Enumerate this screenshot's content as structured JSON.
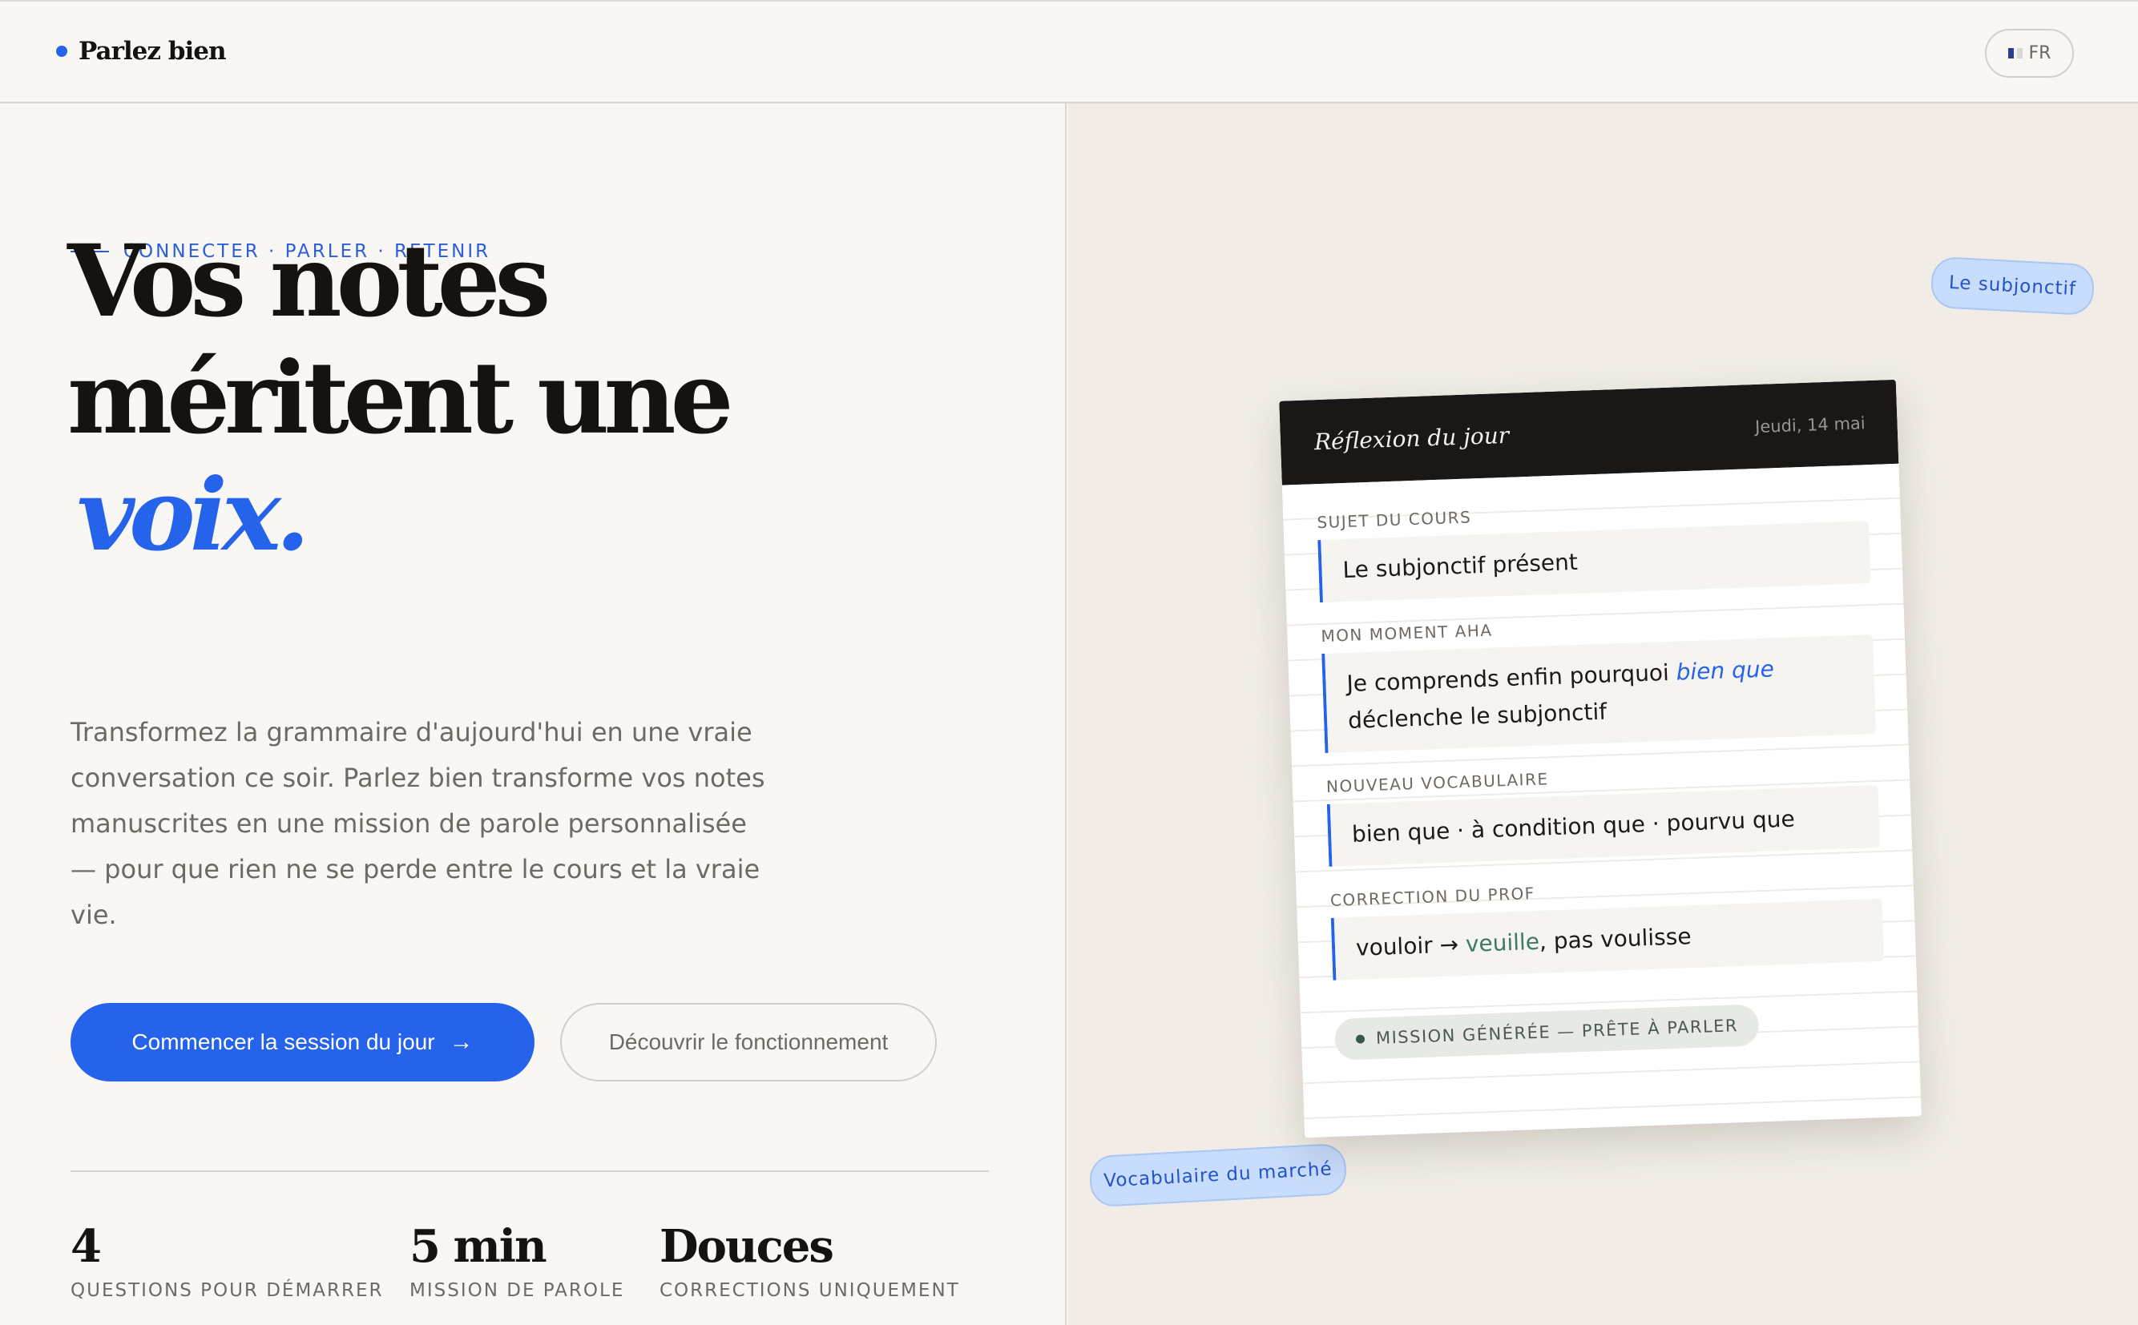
{
  "header": {
    "brand": "Parlez bien",
    "lang_label": "FR"
  },
  "hero": {
    "eyebrow": "CONNECTER · PARLER · RETENIR",
    "title_line1": "Vos notes",
    "title_line2": "méritent une",
    "title_accent": "voix.",
    "lede": "Transformez la grammaire d'aujourd'hui en une vraie conversation ce soir. Parlez bien transforme vos notes manuscrites en une mission de parole personnalisée — pour que rien ne se perde entre le cours et la vraie vie.",
    "primary_cta": "Commencer la session du jour",
    "primary_cta_icon": "→",
    "secondary_cta": "Découvrir le fonctionnement"
  },
  "stats": [
    {
      "value": "4",
      "label": "QUESTIONS POUR DÉMARRER"
    },
    {
      "value": "5 min",
      "label": "MISSION DE PAROLE"
    },
    {
      "value": "Douces",
      "label": "CORRECTIONS UNIQUEMENT"
    }
  ],
  "chips": {
    "top": "Le subjonctif",
    "bottom": "Vocabulaire du marché"
  },
  "card": {
    "title": "Réflexion du jour",
    "date": "Jeudi, 14 mai",
    "fields": {
      "subject_label": "SUJET DU COURS",
      "subject_value": "Le subjonctif présent",
      "aha_label": "MON MOMENT AHA",
      "aha_before": "Je comprends enfin pourquoi ",
      "aha_highlight": "bien que",
      "aha_after": " déclenche le subjonctif",
      "vocab_label": "NOUVEAU VOCABULAIRE",
      "vocab_value": "bien que · à condition que · pourvu que",
      "correction_label": "CORRECTION DU PROF",
      "correction_before": "vouloir → ",
      "correction_highlight": "veuille",
      "correction_after": ", pas voulisse"
    },
    "status": "MISSION GÉNÉRÉE — PRÊTE À PARLER"
  },
  "colors": {
    "accent": "#2563eb",
    "background": "#f9f7f3",
    "panel": "#f1ede6",
    "card_header": "#1a1816"
  }
}
